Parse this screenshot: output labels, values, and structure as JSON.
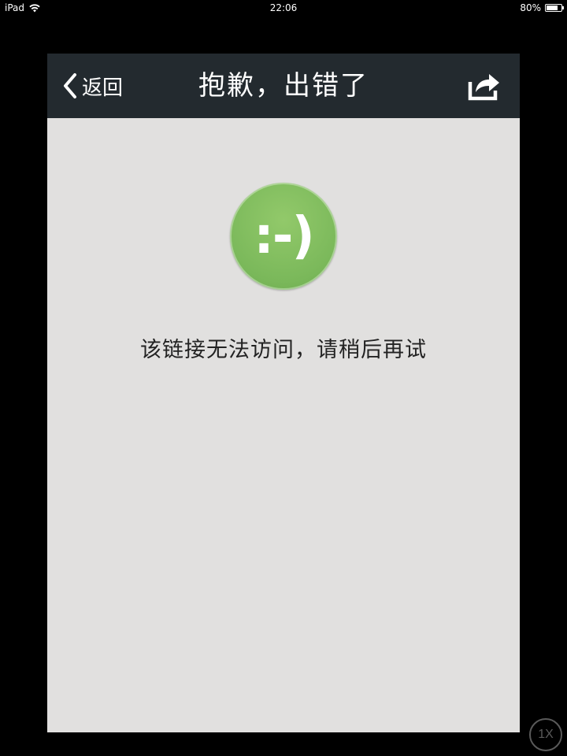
{
  "status_bar": {
    "device": "iPad",
    "time": "22:06",
    "battery_percent": "80%",
    "battery_level": 0.8
  },
  "nav": {
    "back_label": "返回",
    "title": "抱歉，出错了",
    "back_icon": "chevron-left-icon",
    "share_icon": "share-icon"
  },
  "content": {
    "emoticon": ":-)",
    "message": "该链接无法访问，请稍后再试"
  },
  "zoom": {
    "label": "1X"
  },
  "colors": {
    "nav_background": "#232a2f",
    "content_background": "#e1e0df",
    "accent_green": "#7ab85a"
  }
}
